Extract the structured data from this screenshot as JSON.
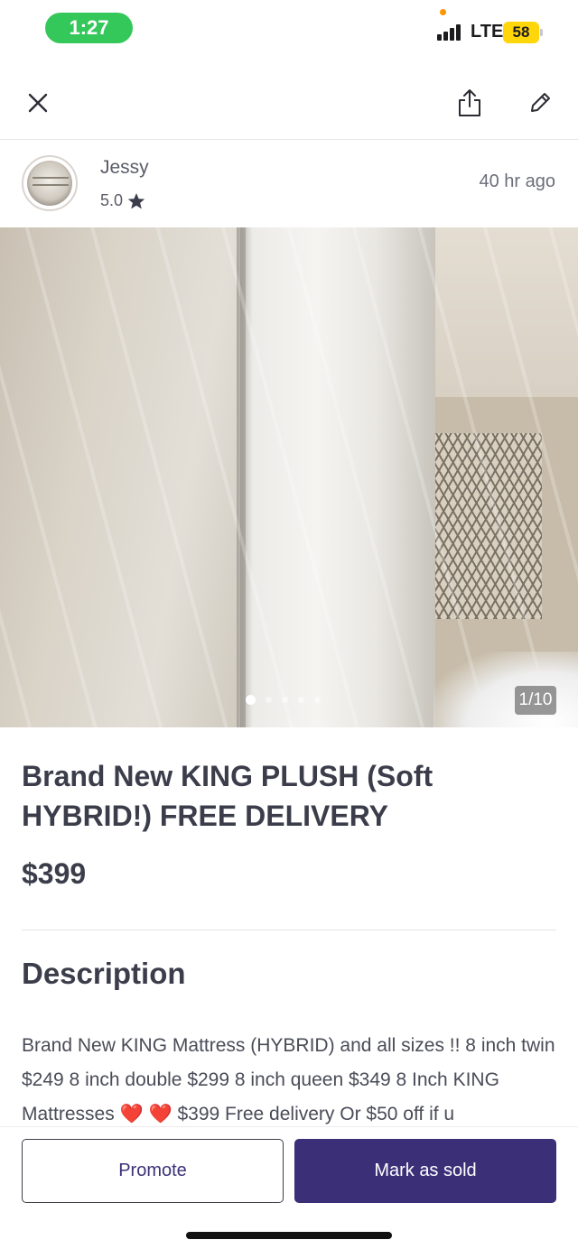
{
  "status_bar": {
    "time": "1:27",
    "network": "LTE",
    "battery": "58"
  },
  "toolbar": {
    "close_icon": "close-icon",
    "share_icon": "share-icon",
    "edit_icon": "pencil-icon"
  },
  "seller": {
    "name": "Jessy",
    "rating": "5.0",
    "rating_icon": "star-icon",
    "posted": "40 hr  ago"
  },
  "gallery": {
    "counter": "1/10",
    "dot_count": 5,
    "active_dot": 1
  },
  "listing": {
    "title": "Brand New KING PLUSH (Soft HYBRID!) FREE DELIVERY",
    "price": "$399",
    "description_heading": "Description",
    "description": "Brand New KING Mattress (HYBRID) and all sizes !! 8 inch twin $249 8 inch double $299 8 inch queen $349 8 Inch KING Mattresses ❤️ ❤️  $399 Free delivery Or $50 off if u"
  },
  "actions": {
    "promote_label": "Promote",
    "mark_sold_label": "Mark as sold"
  },
  "colors": {
    "primary": "#3b2f78",
    "text": "#3b3d4a",
    "time_pill": "#34c759",
    "battery": "#ffd60a"
  }
}
